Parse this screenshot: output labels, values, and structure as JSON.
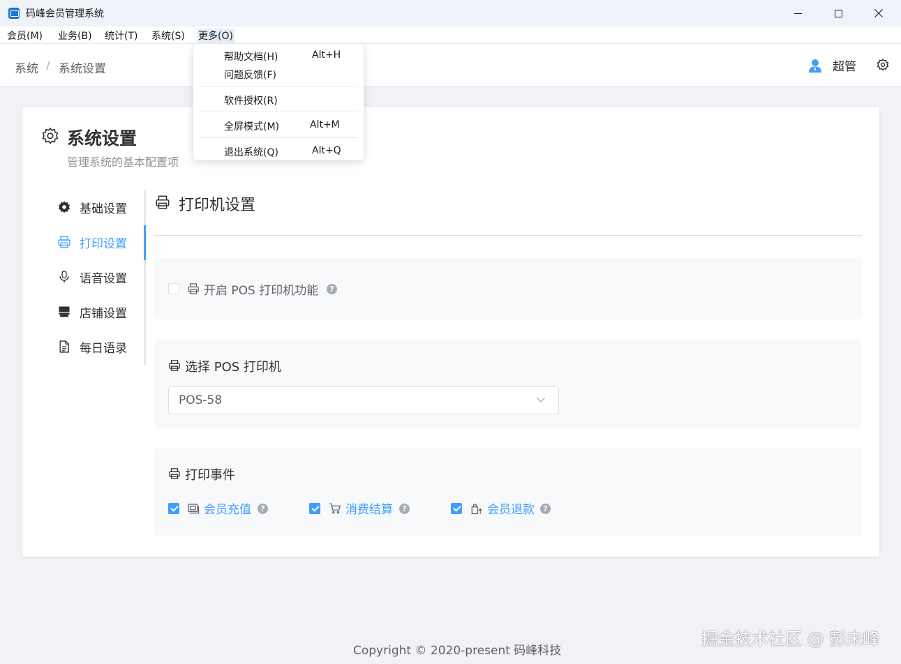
{
  "window": {
    "title": "码峰会员管理系统"
  },
  "menubar": [
    "会员(M)",
    "业务(B)",
    "统计(T)",
    "系统(S)",
    "更多(O)"
  ],
  "dropdown": {
    "items": [
      {
        "label": "帮助文档(H)",
        "shortcut": "Alt+H"
      },
      {
        "label": "问题反馈(F)",
        "shortcut": ""
      },
      {
        "label": "软件授权(R)",
        "shortcut": ""
      },
      {
        "label": "全屏模式(M)",
        "shortcut": "Alt+M"
      },
      {
        "label": "退出系统(Q)",
        "shortcut": "Alt+Q"
      }
    ]
  },
  "breadcrumb": [
    "系统",
    "/",
    "系统设置"
  ],
  "user": {
    "name": "超管"
  },
  "card": {
    "title": "系统设置",
    "subtitle": "管理系统的基本配置项"
  },
  "nav": [
    {
      "label": "基础设置",
      "icon": "gear-icon"
    },
    {
      "label": "打印设置",
      "icon": "printer-icon",
      "active": true
    },
    {
      "label": "语音设置",
      "icon": "microphone-icon"
    },
    {
      "label": "店铺设置",
      "icon": "store-icon"
    },
    {
      "label": "每日语录",
      "icon": "document-icon"
    }
  ],
  "section": {
    "title": "打印机设置"
  },
  "pos_enable": {
    "label": "开启 POS 打印机功能",
    "checked": false
  },
  "printer_select": {
    "label": "选择 POS 打印机",
    "value": "POS-58"
  },
  "print_events": {
    "label": "打印事件",
    "options": [
      {
        "label": "会员充值",
        "checked": true,
        "icon": "recharge-icon"
      },
      {
        "label": "消费结算",
        "checked": true,
        "icon": "cart-icon"
      },
      {
        "label": "会员退款",
        "checked": true,
        "icon": "refund-bag-icon"
      }
    ]
  },
  "help_mark": "?",
  "footer": "Copyright © 2020-present  码峰科技",
  "watermark": "掘金技术社区 @ 彭未峰",
  "colors": {
    "accent": "#409eff",
    "titlebar": "#eef3f9",
    "background": "#f0f2f5"
  }
}
